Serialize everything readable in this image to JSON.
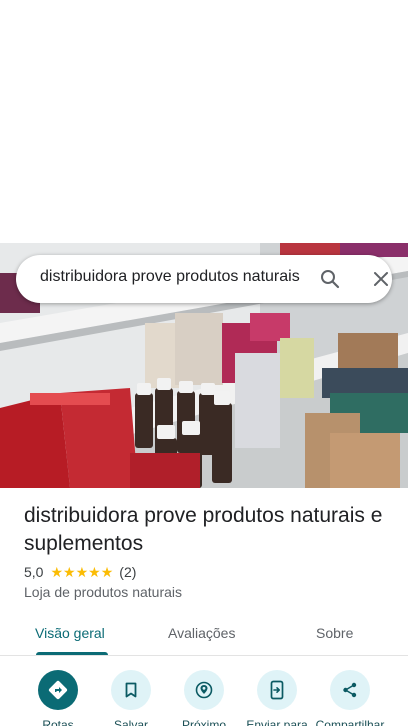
{
  "search": {
    "query": "distribuidora prove produtos naturais e suplementos"
  },
  "place": {
    "name": "distribuidora prove produtos naturais e suplementos",
    "rating": "5,0",
    "stars": 5,
    "review_count": "(2)",
    "category": "Loja de produtos naturais"
  },
  "tabs": [
    {
      "label": "Visão geral",
      "active": true
    },
    {
      "label": "Avaliações",
      "active": false
    },
    {
      "label": "Sobre",
      "active": false
    }
  ],
  "actions": [
    {
      "label": "Rotas",
      "icon": "directions-icon"
    },
    {
      "label": "Salvar",
      "icon": "bookmark-icon"
    },
    {
      "label": "Próximo",
      "icon": "nearby-icon"
    },
    {
      "label": "Enviar para",
      "icon": "send-to-phone-icon"
    },
    {
      "label": "Compartilhar",
      "icon": "share-icon"
    }
  ],
  "colors": {
    "accent": "#0b6b75",
    "action_bg": "#dff3f7",
    "star": "#fbbc04"
  }
}
